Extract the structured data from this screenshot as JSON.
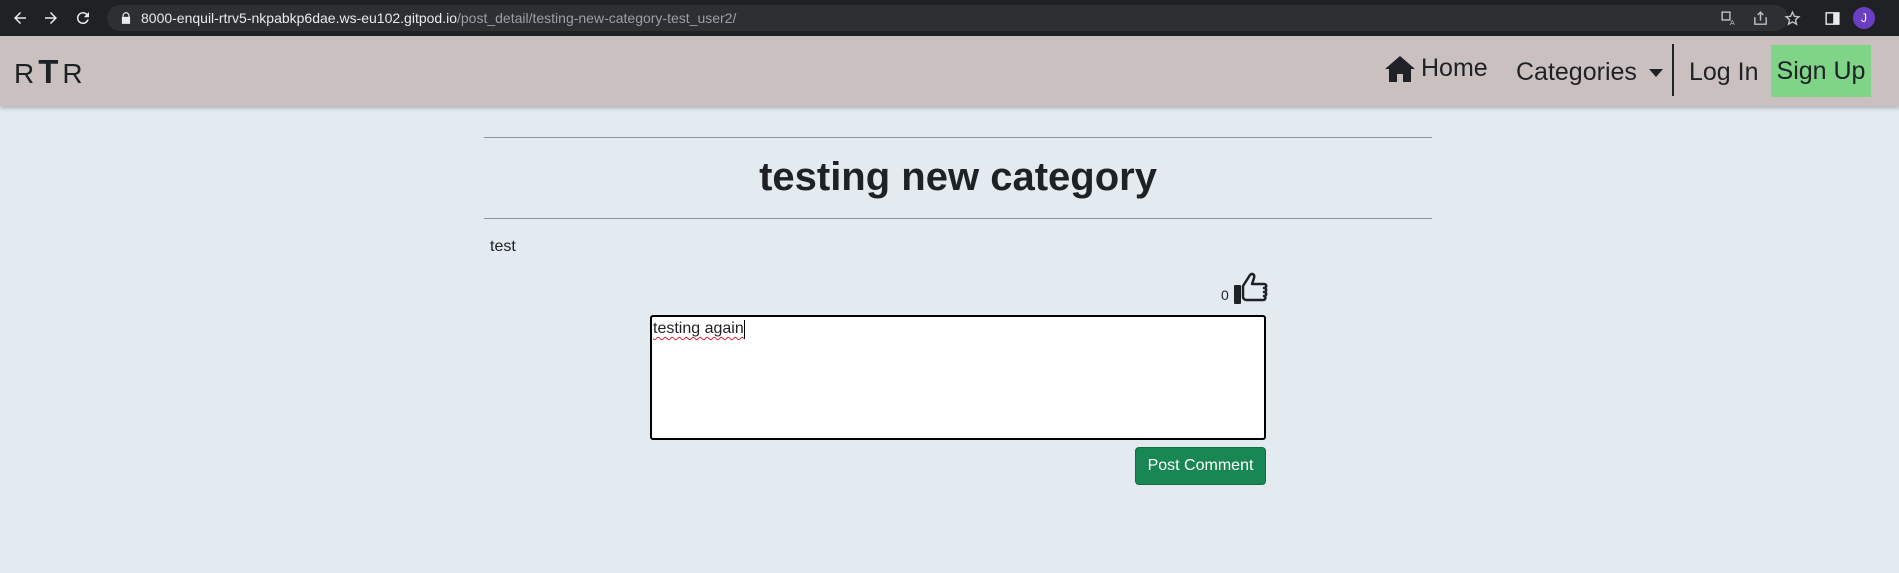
{
  "browser": {
    "url_host": "8000-enquil-rtrv5-nkpabkp6dae.ws-eu102.gitpod.io",
    "url_path": "/post_detail/testing-new-category-test_user2/",
    "profile_initial": "J"
  },
  "navbar": {
    "brand_left": "R",
    "brand_mid": "T",
    "brand_right": "R",
    "home": "Home",
    "categories": "Categories",
    "login": "Log In",
    "signup": "Sign Up"
  },
  "post": {
    "title": "testing new category",
    "body": "test",
    "like_count": "0"
  },
  "comment": {
    "value": "testing again",
    "submit_label": "Post Comment"
  },
  "colors": {
    "page_bg": "#e3eaf0",
    "navbar_bg": "#cbc0c0",
    "signup_bg": "#7fd487",
    "button_bg": "#198754"
  }
}
